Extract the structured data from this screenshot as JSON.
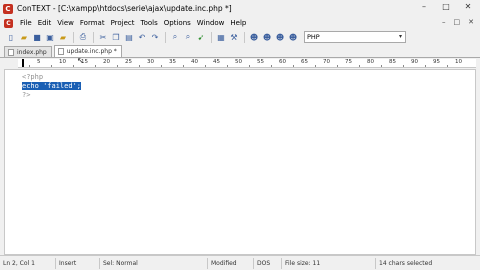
{
  "window": {
    "title": "ConTEXT - [C:\\xampp\\htdocs\\serie\\ajax\\update.inc.php *]",
    "app_icon_letter": "C",
    "controls": [
      "–",
      "□",
      "✕"
    ]
  },
  "menubar": {
    "items": [
      "File",
      "Edit",
      "View",
      "Format",
      "Project",
      "Tools",
      "Options",
      "Window",
      "Help"
    ],
    "mdi_controls": [
      "–",
      "□",
      "✕"
    ]
  },
  "toolbar": {
    "icons": [
      "new-file-icon",
      "open-folder-icon",
      "save-icon",
      "save-all-icon",
      "close-file-icon",
      "print-icon",
      "cut-icon",
      "copy-icon",
      "paste-icon",
      "undo-icon",
      "redo-icon",
      "find-icon",
      "replace-icon",
      "find-next-icon",
      "tools-icon",
      "wrench-icon",
      "user-1-icon",
      "user-2-icon",
      "user-3-icon",
      "user-4-icon"
    ],
    "language": "PHP"
  },
  "tabs": [
    {
      "label": "index.php",
      "active": false
    },
    {
      "label": "update.inc.php *",
      "active": true
    }
  ],
  "ruler": {
    "labels": [
      "5",
      "10",
      "15",
      "20",
      "25",
      "30",
      "35",
      "40",
      "45",
      "50",
      "55",
      "60",
      "65",
      "70",
      "75",
      "80",
      "85",
      "90",
      "95",
      "10"
    ]
  },
  "editor": {
    "lines": [
      {
        "text": "<?php",
        "style": "php-tag"
      },
      {
        "text": "echo 'failed';",
        "style": "selected"
      },
      {
        "text": "?>",
        "style": "php-tag"
      }
    ]
  },
  "statusbar": {
    "position": "Ln 2, Col 1",
    "insert_mode": "Insert",
    "selection_mode": "Sel: Normal",
    "modified": "Modified",
    "line_endings": "DOS",
    "file_size": "File size: 11",
    "selection_info": "14 chars selected"
  }
}
